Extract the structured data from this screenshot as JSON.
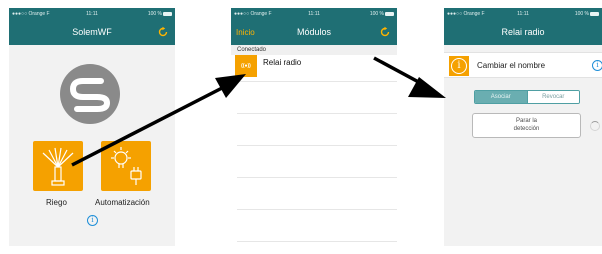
{
  "screens": [
    {
      "status": {
        "carrier": "●●●○○ Orange F",
        "time": "11:11",
        "battery": "100 %"
      },
      "title": "SolemWF",
      "tiles": [
        {
          "label": "Riego",
          "icon": "sprinkler-icon"
        },
        {
          "label": "Automatización",
          "icon": "bulb-plug-icon"
        }
      ],
      "info_icon": "info-icon"
    },
    {
      "status": {
        "carrier": "●●●○○ Orange F",
        "time": "11:11",
        "battery": "100 %"
      },
      "back_label": "Inicio",
      "title": "Módulos",
      "section_header": "Conectado",
      "modules": [
        {
          "name": "Relai radio",
          "badge": "((●))"
        }
      ]
    },
    {
      "status": {
        "carrier": "●●●○○ Orange F",
        "time": "11:11",
        "battery": "100 %"
      },
      "title": "Relai radio",
      "rename_label": "Cambiar el nombre",
      "segment": {
        "options": [
          "Asociar",
          "Revocar"
        ],
        "selected": 0
      },
      "detect_button": [
        "Parar la",
        "detección"
      ]
    }
  ],
  "colors": {
    "nav_bar": "#1f6f74",
    "accent": "#f5a100",
    "info": "#1f8fd8"
  }
}
